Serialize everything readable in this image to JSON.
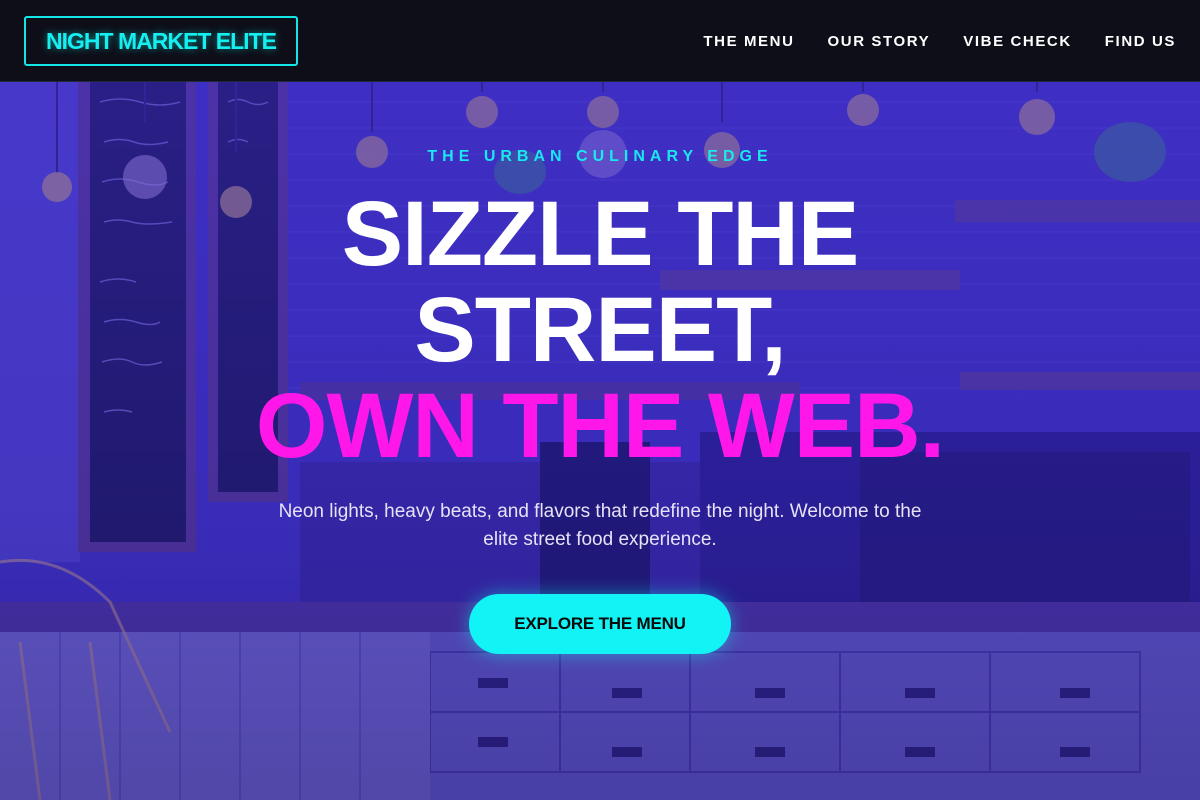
{
  "brand": {
    "logo_text": "NIGHT MARKET ELITE"
  },
  "nav": {
    "items": [
      {
        "label": "THE MENU"
      },
      {
        "label": "OUR STORY"
      },
      {
        "label": "VIBE CHECK"
      },
      {
        "label": "FIND US"
      }
    ]
  },
  "hero": {
    "eyebrow": "THE URBAN CULINARY EDGE",
    "headline_line1": "SIZZLE THE",
    "headline_line2": "STREET,",
    "headline_accent": "OWN THE WEB.",
    "subtitle": "Neon lights, heavy beats, and flavors that redefine the night. Welcome to the elite street food experience.",
    "cta_label": "EXPLORE THE MENU",
    "background_image": "cafe-interior-photo"
  },
  "colors": {
    "accent_cyan": "#12f3f5",
    "accent_magenta": "#ff17ea",
    "header_bg": "#0e0e18",
    "hero_tint": "#3a2fb4"
  }
}
